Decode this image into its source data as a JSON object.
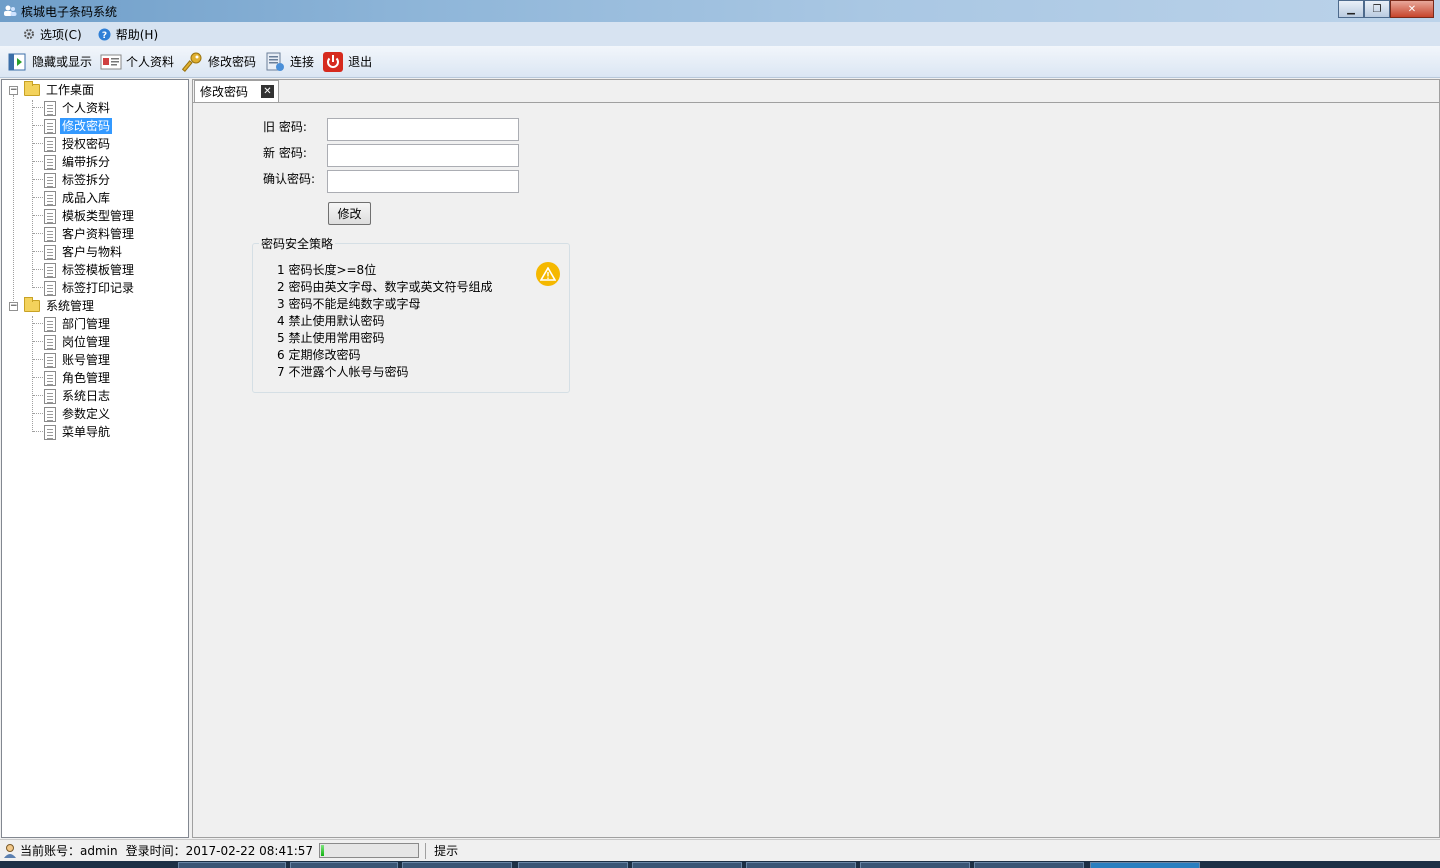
{
  "window": {
    "title": "槟城电子条码系统",
    "controls": {
      "minimize": "▁",
      "maximize": "❐",
      "close": "✕"
    }
  },
  "menubar": {
    "items": [
      {
        "label": "选项(C)",
        "icon": "gear-icon"
      },
      {
        "label": "帮助(H)",
        "icon": "help-icon"
      }
    ]
  },
  "toolbar": {
    "items": [
      {
        "label": "隐藏或显示",
        "icon": "toggle-panel-icon"
      },
      {
        "label": "个人资料",
        "icon": "id-card-icon"
      },
      {
        "label": "修改密码",
        "icon": "key-icon"
      },
      {
        "label": "连接",
        "icon": "connect-icon"
      },
      {
        "label": "退出",
        "icon": "power-icon"
      }
    ]
  },
  "tree": {
    "groups": [
      {
        "label": "工作桌面",
        "expander": "−",
        "children": [
          "个人资料",
          "修改密码",
          "授权密码",
          "编带拆分",
          "标签拆分",
          "成品入库",
          "模板类型管理",
          "客户资料管理",
          "客户与物料",
          "标签模板管理",
          "标签打印记录"
        ]
      },
      {
        "label": "系统管理",
        "expander": "−",
        "children": [
          "部门管理",
          "岗位管理",
          "账号管理",
          "角色管理",
          "系统日志",
          "参数定义",
          "菜单导航"
        ]
      }
    ],
    "selected": "修改密码"
  },
  "tab": {
    "label": "修改密码",
    "close": "✕"
  },
  "form": {
    "old_label": "旧 密码:",
    "new_label": "新 密码:",
    "confirm_label": "确认密码:",
    "old_value": "",
    "new_value": "",
    "confirm_value": "",
    "submit_label": "修改"
  },
  "policy": {
    "title": "密码安全策略",
    "rules": [
      "1 密码长度>=8位",
      "2 密码由英文字母、数字或英文符号组成",
      "3 密码不能是纯数字或字母",
      "4 禁止使用默认密码",
      "5 禁止使用常用密码",
      "6 定期修改密码",
      "7 不泄露个人帐号与密码"
    ],
    "icon": "warning-icon",
    "icon_glyph": "⚠",
    "icon_color": "#f5b800"
  },
  "status": {
    "account": "当前账号：admin",
    "login_time": "登录时间：2017-02-22 08:41:57",
    "progress": 0.03,
    "hint": "提示"
  }
}
